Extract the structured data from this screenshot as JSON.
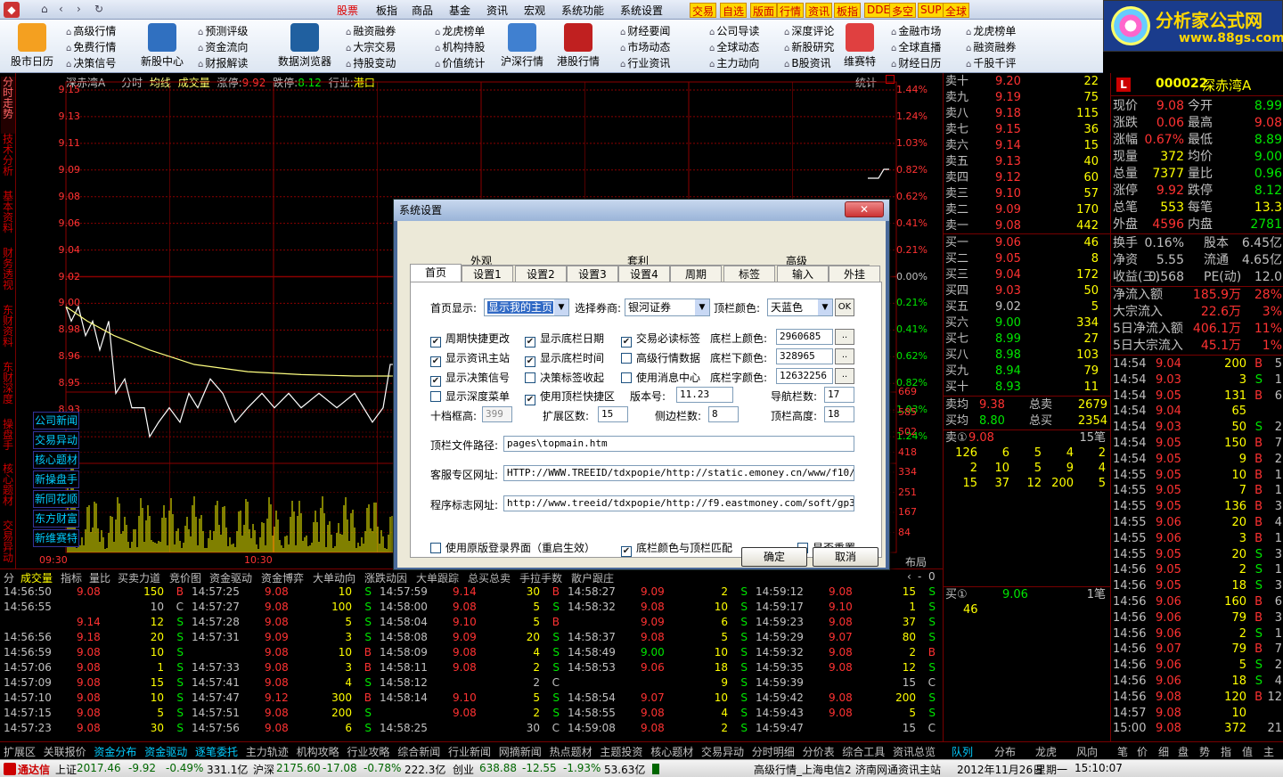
{
  "menubar": {
    "items": [
      "股票",
      "板指",
      "商品",
      "基金",
      "资讯",
      "宏观",
      "系统功能",
      "系统设置"
    ],
    "hot": [
      "交易",
      "自选",
      "版面",
      "行情",
      "资讯",
      "板指",
      "DDE",
      "多空",
      "SUP",
      "全球"
    ]
  },
  "logo": {
    "name": "分析家公式网",
    "url": "www.88gs.com"
  },
  "toolbar": {
    "big": [
      "股市日历",
      "新股中心",
      "数据浏览器",
      "沪深行情",
      "港股行情",
      "维赛特"
    ],
    "small_cols": [
      [
        "高级行情",
        "免费行情",
        "决策信号"
      ],
      [
        "预测评级",
        "资金流向",
        "财报解读"
      ],
      [
        "融资融券",
        "大宗交易",
        "持股变动"
      ],
      [
        "龙虎榜单",
        "机构持股",
        "价值统计"
      ],
      [
        "财经要闻",
        "市场动态",
        "行业资讯"
      ],
      [
        "公司导读",
        "全球动态",
        "主力动向"
      ],
      [
        "深度评论",
        "新股研究",
        "B股资讯"
      ],
      [
        "金融市场",
        "全球直播",
        "财经日历"
      ],
      [
        "龙虎榜单",
        "融资融券",
        "千股千评"
      ]
    ]
  },
  "left_tabs": [
    "分时走势",
    "技术分析",
    "基本资料",
    "财务透视",
    "东财资料",
    "东财深度",
    "操盘手",
    "核心题材",
    "交易异动"
  ],
  "chart": {
    "header": {
      "name": "深赤湾A",
      "type": "分时",
      "avg": "均线",
      "vol": "成交量",
      "limit_up_label": "涨停:",
      "limit_up": "9.92",
      "limit_down_label": "跌停:",
      "limit_down": "8.12",
      "industry_label": "行业:",
      "industry": "港口",
      "stats": "统计"
    },
    "price_ticks": [
      "9.15",
      "9.13",
      "9.11",
      "9.09",
      "9.08",
      "9.06",
      "9.04",
      "9.02",
      "9.00",
      "8.98",
      "8.96",
      "8.95",
      "8.93",
      "8.91"
    ],
    "pct_ticks": [
      "1.44%",
      "1.24%",
      "1.03%",
      "0.82%",
      "0.62%",
      "0.41%",
      "0.21%",
      "0.00%",
      "0.21%",
      "0.41%",
      "0.62%",
      "0.82%",
      "1.03%",
      "1.24%"
    ],
    "vol_ticks": [
      "669",
      "585",
      "502",
      "418",
      "334",
      "251",
      "167",
      "84"
    ],
    "time_labels": [
      "09:30",
      "10:30"
    ],
    "layout_label": "布局",
    "news_buttons": [
      "公司新闻",
      "交易异动",
      "核心题材",
      "新操盘手",
      "新同花顺",
      "东方财富",
      "新维赛特"
    ]
  },
  "bottom_tabs": [
    "分",
    "成交量",
    "指标",
    "量比",
    "买卖力道",
    "竞价图",
    "资金驱动",
    "资金博弈",
    "大单动向",
    "涨跌动因",
    "大单跟踪",
    "总买总卖",
    "手拉手数",
    "散户跟庄"
  ],
  "trades": [
    [
      [
        "14:56:50",
        "9.08",
        "150",
        "B"
      ],
      [
        "14:56:55",
        "",
        "10",
        "C"
      ],
      [
        "",
        "9.14",
        "12",
        "S"
      ],
      [
        "14:56:56",
        "9.18",
        "20",
        "S"
      ],
      [
        "14:56:59",
        "9.08",
        "10",
        "S"
      ],
      [
        "14:57:06",
        "9.08",
        "1",
        "S"
      ],
      [
        "14:57:09",
        "9.08",
        "15",
        "S"
      ],
      [
        "14:57:10",
        "9.08",
        "10",
        "S"
      ],
      [
        "14:57:15",
        "9.08",
        "5",
        "S"
      ],
      [
        "14:57:23",
        "9.08",
        "30",
        "S"
      ]
    ],
    [
      [
        "14:57:25",
        "9.08",
        "10",
        "S"
      ],
      [
        "14:57:27",
        "9.08",
        "100",
        "S"
      ],
      [
        "14:57:28",
        "9.08",
        "5",
        "S"
      ],
      [
        "14:57:31",
        "9.09",
        "3",
        "S"
      ],
      [
        "",
        "9.08",
        "10",
        "B"
      ],
      [
        "14:57:33",
        "9.08",
        "3",
        "B"
      ],
      [
        "14:57:41",
        "9.08",
        "4",
        "S"
      ],
      [
        "14:57:47",
        "9.12",
        "300",
        "B"
      ],
      [
        "14:57:51",
        "9.08",
        "200",
        "S"
      ],
      [
        "14:57:56",
        "9.08",
        "6",
        "S"
      ]
    ],
    [
      [
        "14:57:59",
        "9.14",
        "30",
        "B"
      ],
      [
        "14:58:00",
        "9.08",
        "5",
        "S"
      ],
      [
        "14:58:04",
        "9.10",
        "5",
        "B"
      ],
      [
        "14:58:08",
        "9.09",
        "20",
        "S"
      ],
      [
        "14:58:09",
        "9.08",
        "4",
        "S"
      ],
      [
        "14:58:11",
        "9.08",
        "2",
        "S"
      ],
      [
        "14:58:12",
        "",
        "2",
        "C"
      ],
      [
        "14:58:14",
        "9.10",
        "5",
        "S"
      ],
      [
        "",
        "9.08",
        "2",
        "S"
      ],
      [
        "14:58:25",
        "",
        "30",
        "C"
      ]
    ],
    [
      [
        "14:58:27",
        "9.09",
        "2",
        "S"
      ],
      [
        "14:58:32",
        "9.08",
        "10",
        "S"
      ],
      [
        "",
        "9.09",
        "6",
        "S"
      ],
      [
        "14:58:37",
        "9.08",
        "5",
        "S"
      ],
      [
        "14:58:49",
        "9.00",
        "10",
        "S"
      ],
      [
        "14:58:53",
        "9.06",
        "18",
        "S"
      ],
      [
        "",
        "",
        "9",
        "S"
      ],
      [
        "14:58:54",
        "9.07",
        "10",
        "S"
      ],
      [
        "14:58:55",
        "9.08",
        "4",
        "S"
      ],
      [
        "14:59:08",
        "9.08",
        "2",
        "S"
      ]
    ],
    [
      [
        "14:59:12",
        "9.08",
        "15",
        "S"
      ],
      [
        "14:59:17",
        "9.10",
        "1",
        "S"
      ],
      [
        "14:59:23",
        "9.08",
        "37",
        "S"
      ],
      [
        "14:59:29",
        "9.07",
        "80",
        "S"
      ],
      [
        "14:59:32",
        "9.08",
        "2",
        "B"
      ],
      [
        "14:59:35",
        "9.08",
        "12",
        "S"
      ],
      [
        "14:59:39",
        "",
        "15",
        "C"
      ],
      [
        "14:59:42",
        "9.08",
        "200",
        "S"
      ],
      [
        "14:59:43",
        "9.08",
        "5",
        "S"
      ],
      [
        "14:59:47",
        "",
        "15",
        "C"
      ]
    ]
  ],
  "orderbook": {
    "sell": [
      [
        "卖十",
        "9.20",
        "22"
      ],
      [
        "卖九",
        "9.19",
        "75"
      ],
      [
        "卖八",
        "9.18",
        "115"
      ],
      [
        "卖七",
        "9.15",
        "36"
      ],
      [
        "卖六",
        "9.14",
        "15"
      ],
      [
        "卖五",
        "9.13",
        "40"
      ],
      [
        "卖四",
        "9.12",
        "60"
      ],
      [
        "卖三",
        "9.10",
        "57"
      ],
      [
        "卖二",
        "9.09",
        "170"
      ],
      [
        "卖一",
        "9.08",
        "442"
      ]
    ],
    "buy": [
      [
        "买一",
        "9.06",
        "46"
      ],
      [
        "买二",
        "9.05",
        "8"
      ],
      [
        "买三",
        "9.04",
        "172"
      ],
      [
        "买四",
        "9.03",
        "50"
      ],
      [
        "买五",
        "9.02",
        "5"
      ],
      [
        "买六",
        "9.00",
        "334"
      ],
      [
        "买七",
        "8.99",
        "27"
      ],
      [
        "买八",
        "8.98",
        "103"
      ],
      [
        "买九",
        "8.94",
        "79"
      ],
      [
        "买十",
        "8.93",
        "11"
      ]
    ],
    "avg_sell": [
      "卖均",
      "9.38",
      "总卖",
      "2679"
    ],
    "avg_buy": [
      "买均",
      "8.80",
      "总买",
      "2354"
    ],
    "sell1_detail": [
      "卖①",
      "9.08",
      "15笔"
    ],
    "sell1_orders": [
      [
        "126",
        "6",
        "5",
        "4",
        "2"
      ],
      [
        "2",
        "10",
        "5",
        "9",
        "4"
      ],
      [
        "15",
        "37",
        "12",
        "200",
        "5"
      ]
    ],
    "buy1_detail": [
      "买①",
      "9.06",
      "1笔"
    ],
    "buy1_orders": [
      "46"
    ]
  },
  "quote": {
    "code": "000022",
    "name": "深赤湾A",
    "badge": "L",
    "rows": [
      [
        "现价",
        "9.08",
        "今开",
        "8.99"
      ],
      [
        "涨跌",
        "0.06",
        "最高",
        "9.08"
      ],
      [
        "涨幅",
        "0.67%",
        "最低",
        "8.89"
      ],
      [
        "现量",
        "372",
        "均价",
        "9.00"
      ],
      [
        "总量",
        "7377",
        "量比",
        "0.96"
      ],
      [
        "涨停",
        "9.92",
        "跌停",
        "8.12"
      ],
      [
        "总笔",
        "553",
        "每笔",
        "13.3"
      ],
      [
        "外盘",
        "4596",
        "内盘",
        "2781"
      ]
    ],
    "rows2": [
      [
        "换手",
        "0.16%",
        "股本",
        "6.45亿"
      ],
      [
        "净资",
        "5.55",
        "流通",
        "4.65亿"
      ],
      [
        "收益(三)",
        "0.568",
        "PE(动)",
        "12.0"
      ]
    ],
    "flows": [
      [
        "净流入额",
        "185.9万",
        "28%"
      ],
      [
        "大宗流入",
        "22.6万",
        "3%"
      ],
      [
        "5日净流入额",
        "406.1万",
        "11%"
      ],
      [
        "5日大宗流入",
        "45.1万",
        "1%"
      ]
    ],
    "ticks": [
      [
        "14:54",
        "9.04",
        "200",
        "B",
        "5"
      ],
      [
        "14:54",
        "9.03",
        "3",
        "S",
        "1"
      ],
      [
        "14:54",
        "9.05",
        "131",
        "B",
        "6"
      ],
      [
        "14:54",
        "9.04",
        "65",
        "",
        ""
      ],
      [
        "14:54",
        "9.03",
        "50",
        "S",
        "2"
      ],
      [
        "14:54",
        "9.05",
        "150",
        "B",
        "7"
      ],
      [
        "14:54",
        "9.05",
        "9",
        "B",
        "2"
      ],
      [
        "14:55",
        "9.05",
        "10",
        "B",
        "1"
      ],
      [
        "14:55",
        "9.05",
        "7",
        "B",
        "1"
      ],
      [
        "14:55",
        "9.05",
        "136",
        "B",
        "3"
      ],
      [
        "14:55",
        "9.06",
        "20",
        "B",
        "4"
      ],
      [
        "14:55",
        "9.06",
        "3",
        "B",
        "1"
      ],
      [
        "14:55",
        "9.05",
        "20",
        "S",
        "3"
      ],
      [
        "14:56",
        "9.05",
        "2",
        "S",
        "1"
      ],
      [
        "14:56",
        "9.05",
        "18",
        "S",
        "3"
      ],
      [
        "14:56",
        "9.06",
        "160",
        "B",
        "6"
      ],
      [
        "14:56",
        "9.06",
        "79",
        "B",
        "3"
      ],
      [
        "14:56",
        "9.06",
        "2",
        "S",
        "1"
      ],
      [
        "14:56",
        "9.07",
        "79",
        "B",
        "7"
      ],
      [
        "14:56",
        "9.06",
        "5",
        "S",
        "2"
      ],
      [
        "14:56",
        "9.06",
        "18",
        "S",
        "4"
      ],
      [
        "14:56",
        "9.08",
        "120",
        "B",
        "12"
      ],
      [
        "14:57",
        "9.08",
        "10",
        "",
        ""
      ],
      [
        "15:00",
        "9.08",
        "372",
        "",
        "21"
      ]
    ]
  },
  "statusbar": {
    "tabs": [
      "扩展区",
      "关联报价",
      "资金分布",
      "资金驱动",
      "逐笔委托",
      "主力轨迹",
      "机构攻略",
      "行业攻略",
      "综合新闻",
      "行业新闻",
      "网摘新闻",
      "热点题材",
      "主题投资",
      "核心题材",
      "交易异动",
      "分时明细",
      "分价表",
      "综合工具",
      "资讯总览"
    ],
    "right_tabs": [
      "队列",
      "分布",
      "龙虎",
      "风向",
      "笔",
      "价",
      "细",
      "盘",
      "势",
      "指",
      "值",
      "主"
    ]
  },
  "infobar": {
    "brand": "通达信",
    "sh_label": "上证",
    "sh_val": "2017.46",
    "sh_chg": "-9.92",
    "sh_pct": "-0.49%",
    "sh_amt": "331.1亿",
    "hs_label": "沪深",
    "hs_val": "2175.60",
    "hs_chg": "-17.08",
    "hs_pct": "-0.78%",
    "hs_amt": "222.3亿",
    "cy_label": "创业",
    "cy_val": "638.88",
    "cy_chg": "-12.55",
    "cy_pct": "-1.93%",
    "cy_amt": "53.63亿",
    "server": "高级行情_上海电信2",
    "site": "济南网通资讯主站",
    "date": "2012年11月26日",
    "weekday": "星期一",
    "time": "15:10:07"
  },
  "dialog": {
    "title": "系统设置",
    "close": "✕",
    "groups": [
      "外观",
      "套利",
      "高级"
    ],
    "tabs": [
      "首页",
      "设置1",
      "设置2",
      "设置3",
      "设置4",
      "周期",
      "标签",
      "输入",
      "外挂"
    ],
    "homepage_label": "首页显示:",
    "homepage_value": "显示我的主页",
    "broker_label": "选择券商:",
    "broker_value": "银河证券",
    "topcolor_label": "顶栏颜色:",
    "topcolor_value": "天蓝色",
    "ok_small": "OK",
    "checks": [
      [
        "周期快捷更改",
        true
      ],
      [
        "显示底栏日期",
        true
      ],
      [
        "交易必读标签",
        true
      ],
      [
        "显示资讯主站",
        true
      ],
      [
        "显示底栏时间",
        true
      ],
      [
        "高级行情数据",
        false
      ],
      [
        "显示决策信号",
        true
      ],
      [
        "决策标签收起",
        false
      ],
      [
        "使用消息中心",
        false
      ],
      [
        "显示深度菜单",
        false
      ],
      [
        "使用顶栏快捷区",
        true
      ]
    ],
    "bottom_bg_label": "底栏上颜色:",
    "bottom_bg": "2960685",
    "bottom_dn_label": "底栏下颜色:",
    "bottom_dn": "328965",
    "bottom_fg_label": "底栏字颜色:",
    "bottom_fg": "12632256",
    "version_label": "版本号:",
    "version": "11.23",
    "nav_label": "导航栏数:",
    "nav": "17",
    "ten_label": "十档框高:",
    "ten": "399",
    "ext_label": "扩展区数:",
    "ext": "15",
    "side_label": "侧边栏数:",
    "side": "8",
    "top_h_label": "顶栏高度:",
    "top_h": "18",
    "topfile_label": "顶栏文件路径:",
    "topfile": "pages\\topmain.htm",
    "cs_label": "客服专区网址:",
    "cs": "HTTP://WWW.TREEID/tdxpopie/http://static.emoney.cn/www/f10/f10/cp",
    "logo_label": "程序标志网址:",
    "logo_url": "http://www.treeid/tdxpopie/http://f9.eastmoney.com/soft/gp30.php?",
    "bottom_checks": [
      [
        "使用原版登录界面（重启生效）",
        false
      ],
      [
        "底栏颜色与顶栏匹配",
        true
      ],
      [
        "是否重置",
        false
      ]
    ],
    "confirm": "确定",
    "cancel": "取消"
  },
  "colors": {
    "up": "#ff3232",
    "down": "#00e600",
    "grid": "#8b0000",
    "volume": "#ffff00",
    "avg": "#ffff80"
  }
}
